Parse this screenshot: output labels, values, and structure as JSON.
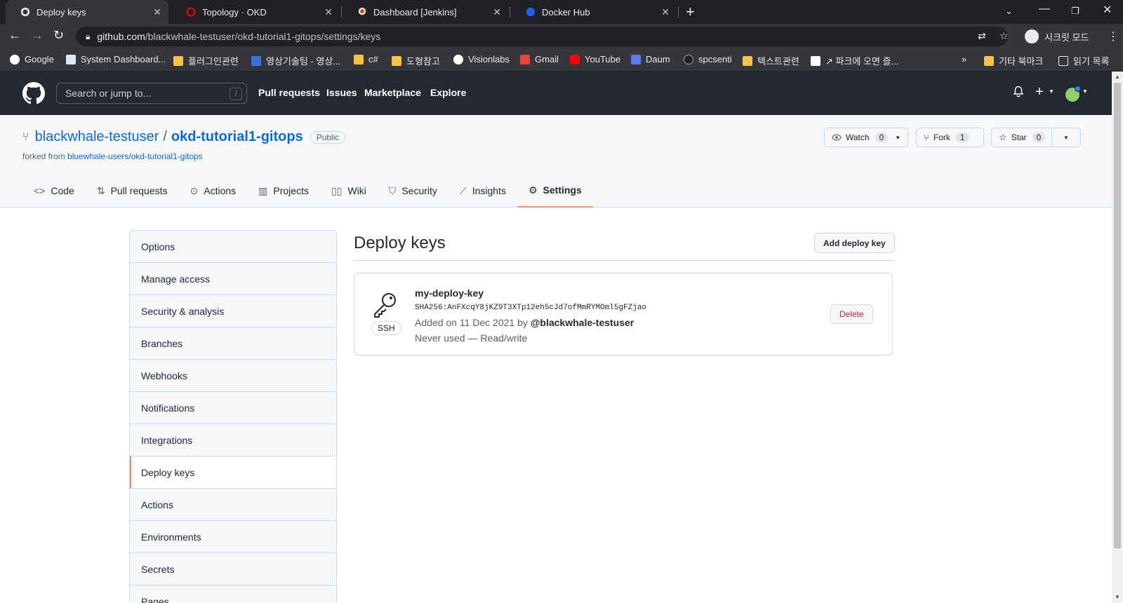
{
  "browser": {
    "tabs": [
      {
        "title": "Deploy keys",
        "icon": "github-icon"
      },
      {
        "title": "Topology · OKD",
        "icon": "openshift-icon"
      },
      {
        "title": "Dashboard [Jenkins]",
        "icon": "jenkins-icon"
      },
      {
        "title": "Docker Hub",
        "icon": "docker-icon"
      }
    ],
    "url_host": "github.com",
    "url_path": "/blackwhale-testuser/okd-tutorial1-gitops/settings/keys",
    "profile_label": "시크릿 모드",
    "bookmarks": [
      "Google",
      "System Dashboard...",
      "플러그인관련",
      "영상기술팀 - 영상...",
      "c#",
      "도형참고",
      "Visionlabs",
      "Gmail",
      "YouTube",
      "Daum",
      "spcsenti",
      "텍스트관련",
      "↗ 파크에 오면 즐...",
      "»",
      "기타 북마크",
      "읽기 목록"
    ]
  },
  "github": {
    "search_placeholder": "Search or jump to...",
    "search_shortcut": "/",
    "nav": [
      "Pull requests",
      "Issues",
      "Marketplace",
      "Explore"
    ]
  },
  "repo": {
    "owner": "blackwhale-testuser",
    "separator": "/",
    "name": "okd-tutorial1-gitops",
    "visibility": "Public",
    "forked_prefix": "forked from",
    "forked_from": "bluewhale-users/okd-tutorial1-gitops",
    "watch_label": "Watch",
    "watch_count": "0",
    "fork_label": "Fork",
    "fork_count": "1",
    "star_label": "Star",
    "star_count": "0",
    "tabs": [
      "Code",
      "Pull requests",
      "Actions",
      "Projects",
      "Wiki",
      "Security",
      "Insights",
      "Settings"
    ]
  },
  "settings": {
    "menu": [
      "Options",
      "Manage access",
      "Security & analysis",
      "Branches",
      "Webhooks",
      "Notifications",
      "Integrations",
      "Deploy keys",
      "Actions",
      "Environments",
      "Secrets",
      "Pages"
    ],
    "selected": "Deploy keys"
  },
  "deploy_keys": {
    "title": "Deploy keys",
    "add_button": "Add deploy key",
    "key": {
      "name": "my-deploy-key",
      "fingerprint": "SHA256:AnFXcqY8jKZ9T3XTp12eh5cJd7ofMmRYMOml5gFZjao",
      "added_prefix": "Added on 11 Dec 2021 by",
      "added_by": "@blackwhale-testuser",
      "usage": "Never used — Read/write",
      "type": "SSH",
      "delete_label": "Delete"
    }
  },
  "colors": {
    "github_header": "#24292f",
    "link": "#0969da",
    "tab_underline": "#fd8c73",
    "danger": "#cf222e"
  }
}
